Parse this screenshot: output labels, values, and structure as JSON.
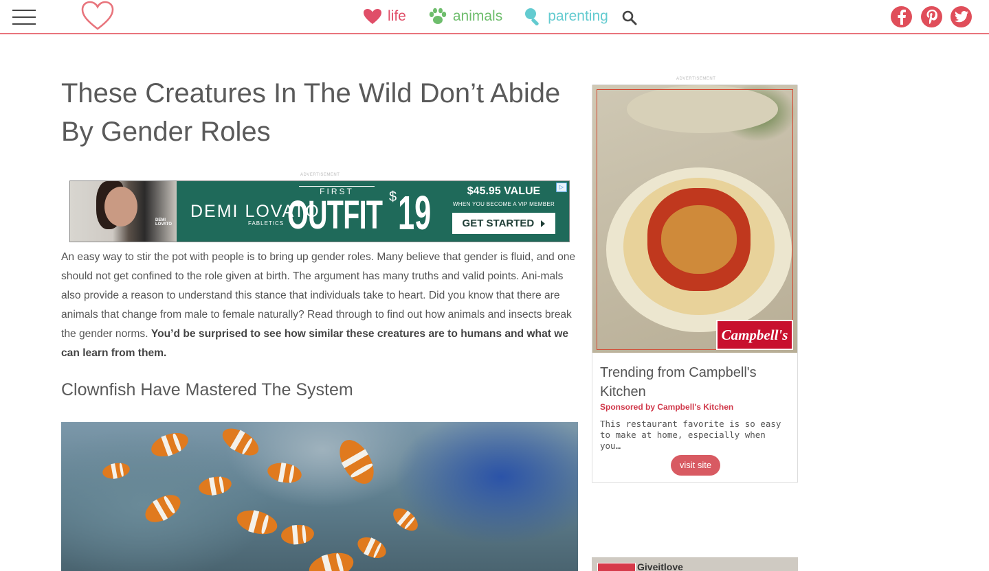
{
  "header": {
    "nav": [
      {
        "label": "life",
        "icon": "heart-icon",
        "color": "#e04e68"
      },
      {
        "label": "animals",
        "icon": "paw-icon",
        "color": "#6ebd6c"
      },
      {
        "label": "parenting",
        "icon": "rattle-icon",
        "color": "#63cbd0"
      }
    ],
    "social": [
      "facebook-icon",
      "pinterest-icon",
      "twitter-icon"
    ],
    "accent_color": "#e8747c"
  },
  "article": {
    "title": "These Creatures In The Wild Don’t Abide By Gender Roles",
    "ad_label": "ADVERTISEMENT",
    "intro": "An easy way to stir the pot with people is to bring up gender roles. Many believe that gender is fluid, and one should not get confined to the role given at birth. The argument has many truths and valid points. Ani-mals also provide a reason to understand this stance that individuals take to heart. Did you know that there are animals that change from male to female naturally? Read through to find out how animals and insects break the gender norms. ",
    "intro_bold": "You’d be surprised to see how similar these creatures are to humans and what we can learn from them.",
    "subhead": "Clownfish Have Mastered The System"
  },
  "banner_ad": {
    "photo_caption": "DEMI LOVATO",
    "brand": "DEMI LOVATO",
    "brand_sub": "FABLETICS",
    "first": "FIRST",
    "outfit": "OUTFIT",
    "dollar": "$",
    "price": "19",
    "value": "$45.95 VALUE",
    "vip": "WHEN YOU BECOME A VIP MEMBER",
    "cta": "GET STARTED"
  },
  "sidebar": {
    "ad_label": "ADVERTISEMENT",
    "brand": "Campbell's",
    "title": "Trending from Campbell's Kitchen",
    "sponsor": "Sponsored by Campbell's Kitchen",
    "description": "This restaurant favorite is so easy to make at home, especially when you…",
    "button": "visit site",
    "ad2_text": "Giveitlove"
  }
}
